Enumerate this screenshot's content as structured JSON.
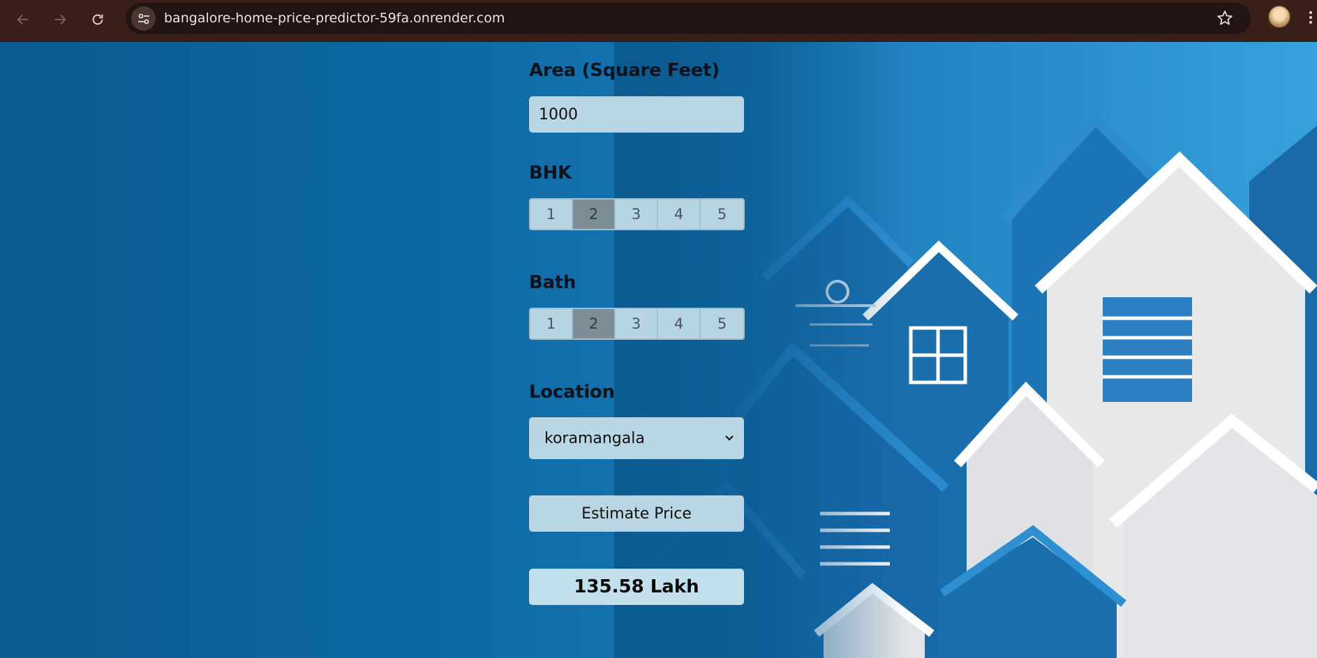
{
  "browser": {
    "url": "bangalore-home-price-predictor-59fa.onrender.com",
    "icons": [
      "back-arrow-icon",
      "forward-arrow-icon",
      "reload-icon",
      "site-settings-icon",
      "bookmark-star-icon",
      "profile-avatar",
      "menu-icon"
    ]
  },
  "form": {
    "area": {
      "label": "Area (Square Feet)",
      "value": "1000"
    },
    "bhk": {
      "label": "BHK",
      "options": [
        "1",
        "2",
        "3",
        "4",
        "5"
      ],
      "selected": "2"
    },
    "bath": {
      "label": "Bath",
      "options": [
        "1",
        "2",
        "3",
        "4",
        "5"
      ],
      "selected": "2"
    },
    "location": {
      "label": "Location",
      "selected": "koramangala"
    },
    "estimate_label": "Estimate Price",
    "result": "135.58 Lakh"
  },
  "colors": {
    "chrome": "#3a1f19",
    "page_bg": "#0e6aa4",
    "field_bg": "#b8d6e4",
    "segment_selected": "#7c8d96"
  }
}
